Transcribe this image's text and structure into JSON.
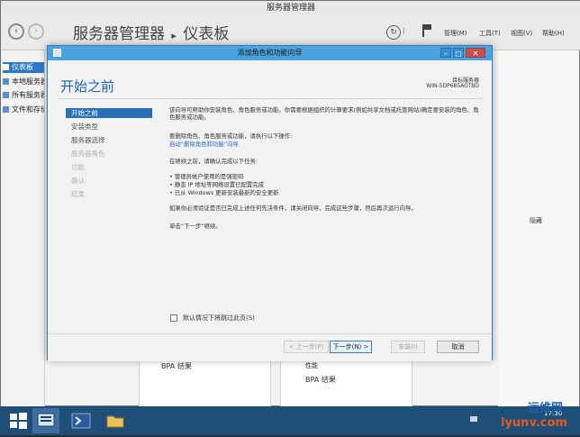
{
  "server_manager": {
    "window_title": "服务器管理器",
    "breadcrumb_app": "服务器管理器",
    "breadcrumb_sep": "▸",
    "breadcrumb_page": "仪表板",
    "menu": {
      "manage": "管理(M)",
      "tools": "工具(T)",
      "view": "视图(V)",
      "help": "帮助(H)"
    },
    "sidebar": {
      "items": [
        {
          "label": "仪表板"
        },
        {
          "label": "本地服务器"
        },
        {
          "label": "所有服务器"
        },
        {
          "label": "文件和存储服务"
        }
      ]
    },
    "right_panel": {
      "hide_label": "隐藏"
    },
    "bottom_tiles": {
      "left": {
        "bpa": "BPA 结果"
      },
      "right": {
        "perf": "性能",
        "bpa": "BPA 结果"
      }
    }
  },
  "dialog": {
    "title": "添加角色和功能向导",
    "heading": "开始之前",
    "target_label": "目标服务器",
    "target_value": "WIN-5DP685AGTBO",
    "steps": [
      {
        "label": "开始之前",
        "state": "active"
      },
      {
        "label": "安装类型",
        "state": "enabled"
      },
      {
        "label": "服务器选择",
        "state": "enabled"
      },
      {
        "label": "服务器角色",
        "state": "disabled"
      },
      {
        "label": "功能",
        "state": "disabled"
      },
      {
        "label": "确认",
        "state": "disabled"
      },
      {
        "label": "结果",
        "state": "disabled"
      }
    ],
    "content": {
      "intro": "该向导可帮助你安装角色、角色服务或功能。你需要根据组织的计算要求(例如共享文档或托管网站)确定要安装的角色、角色服务或功能。",
      "remove_intro": "要删除角色、角色服务或功能，请执行以下操作:",
      "remove_link": "启动“删除角色和功能”向导",
      "confirm_intro": "在继续之前，请确认完成以下任务:",
      "bullets": [
        "管理员帐户使用的是强密码",
        "静态 IP 地址等网络设置已配置完成",
        "已从 Windows 更新安装最新的安全更新"
      ],
      "prereq_note": "如果你必须验证是否已完成上述任何先决条件，请关闭向导，完成这些步骤，然后再次运行向导。",
      "continue_note": "单击“下一步”继续。"
    },
    "checkbox_label": "默认情况下将跳过此页(S)",
    "buttons": {
      "prev": "< 上一步(P)",
      "next": "下一步(N) >",
      "install": "安装(I)",
      "cancel": "取消"
    }
  },
  "taskbar": {
    "clock_time": "17:30"
  },
  "watermark": {
    "brand": "运维网",
    "domain": "iyunv.com"
  },
  "colors": {
    "dialog_accent": "#4aa3df",
    "heading_blue": "#1c65b3",
    "active_step": "#2a6fb7",
    "taskbar": "#1f4e79"
  }
}
